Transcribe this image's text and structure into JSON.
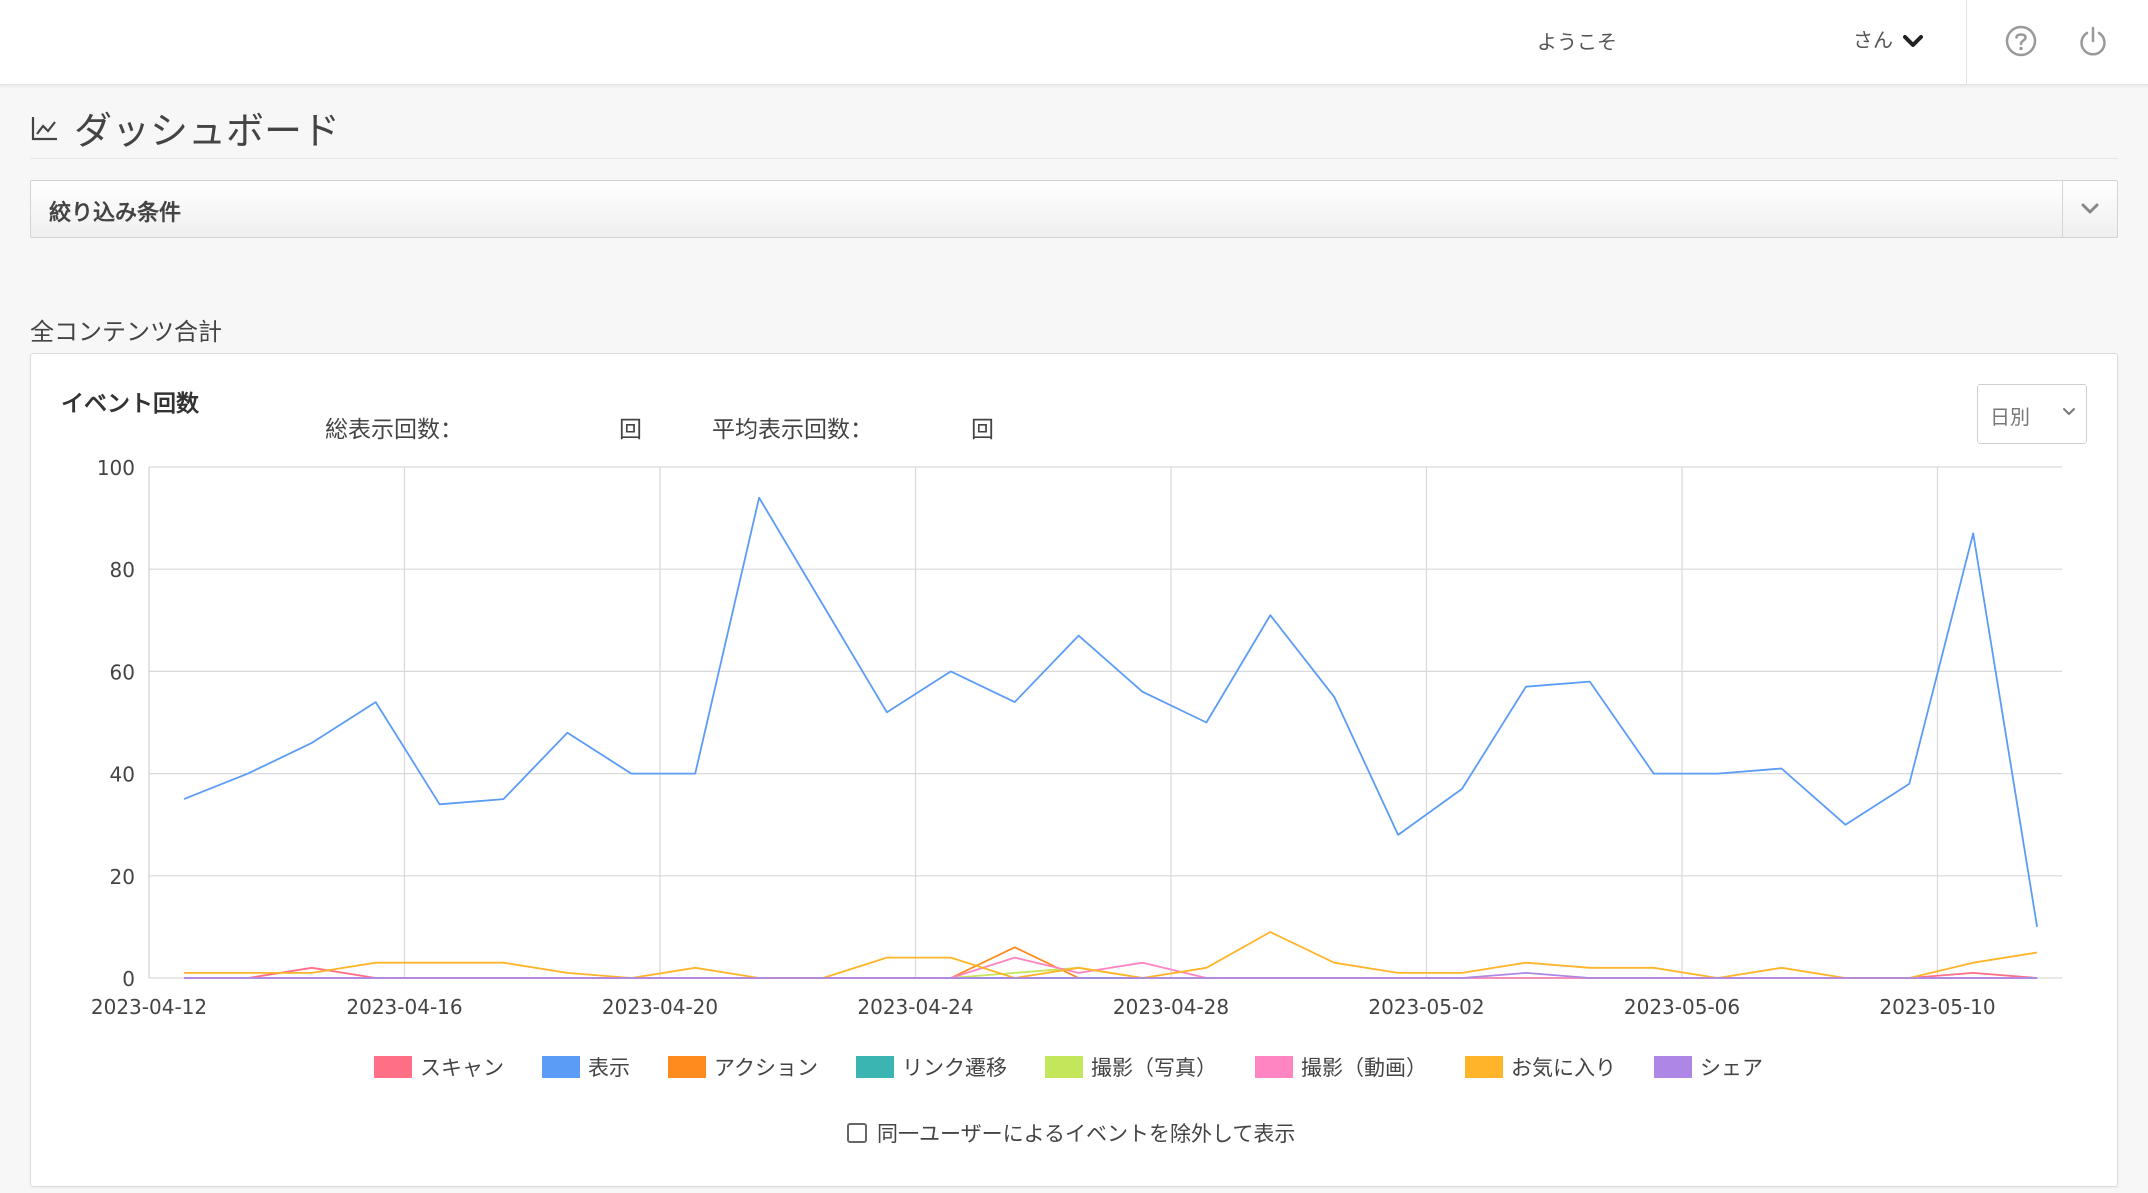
{
  "header": {
    "welcome": "ようこそ",
    "user_suffix": "さん",
    "help_icon": "question-circle-icon",
    "power_icon": "power-icon"
  },
  "page": {
    "title": "ダッシュボード",
    "title_icon": "line-chart-icon"
  },
  "filter": {
    "label": "絞り込み条件"
  },
  "section": {
    "title": "全コンテンツ合計"
  },
  "chart_card": {
    "title": "イベント回数",
    "total_label": "総表示回数：",
    "total_unit": "回",
    "avg_label": "平均表示回数：",
    "avg_unit": "回",
    "period_select": {
      "selected": "日別"
    },
    "exclude_label": "同一ユーザーによるイベントを除外して表示",
    "exclude_checked": false
  },
  "chart_data": {
    "type": "line",
    "x": [
      "2023-04-12",
      "2023-04-13",
      "2023-04-14",
      "2023-04-15",
      "2023-04-16",
      "2023-04-17",
      "2023-04-18",
      "2023-04-19",
      "2023-04-20",
      "2023-04-21",
      "2023-04-22",
      "2023-04-23",
      "2023-04-24",
      "2023-04-25",
      "2023-04-26",
      "2023-04-27",
      "2023-04-28",
      "2023-04-29",
      "2023-04-30",
      "2023-05-01",
      "2023-05-02",
      "2023-05-03",
      "2023-05-04",
      "2023-05-05",
      "2023-05-06",
      "2023-05-07",
      "2023-05-08",
      "2023-05-09",
      "2023-05-10",
      "2023-05-11"
    ],
    "x_ticks": [
      "2023-04-12",
      "2023-04-16",
      "2023-04-20",
      "2023-04-24",
      "2023-04-28",
      "2023-05-02",
      "2023-05-06",
      "2023-05-10"
    ],
    "ylim": [
      0,
      100
    ],
    "y_ticks": [
      0,
      20,
      40,
      60,
      80,
      100
    ],
    "grid": true,
    "legend_position": "bottom",
    "series": [
      {
        "name": "スキャン",
        "color": "#ff6f86",
        "values": [
          0,
          0,
          2,
          0,
          0,
          0,
          0,
          0,
          0,
          0,
          0,
          0,
          0,
          0,
          0,
          0,
          0,
          0,
          0,
          0,
          0,
          0,
          0,
          0,
          0,
          0,
          0,
          0,
          1,
          0
        ]
      },
      {
        "name": "表示",
        "color": "#5b9cf6",
        "values": [
          35,
          40,
          46,
          54,
          34,
          35,
          48,
          40,
          40,
          94,
          73,
          52,
          60,
          54,
          67,
          56,
          50,
          71,
          55,
          28,
          37,
          57,
          58,
          40,
          40,
          41,
          30,
          38,
          87,
          10
        ]
      },
      {
        "name": "アクション",
        "color": "#ff8a1e",
        "values": [
          0,
          0,
          0,
          0,
          0,
          0,
          0,
          0,
          0,
          0,
          0,
          0,
          0,
          6,
          0,
          0,
          0,
          0,
          0,
          0,
          0,
          0,
          0,
          0,
          0,
          0,
          0,
          0,
          0,
          0
        ]
      },
      {
        "name": "リンク遷移",
        "color": "#3ab5b2",
        "values": [
          0,
          0,
          0,
          0,
          0,
          0,
          0,
          0,
          0,
          0,
          0,
          0,
          0,
          0,
          0,
          0,
          0,
          0,
          0,
          0,
          0,
          0,
          0,
          0,
          0,
          0,
          0,
          0,
          0,
          0
        ]
      },
      {
        "name": "撮影（写真）",
        "color": "#c4e65a",
        "values": [
          0,
          0,
          0,
          0,
          0,
          0,
          0,
          0,
          0,
          0,
          0,
          0,
          0,
          1,
          2,
          0,
          0,
          0,
          0,
          0,
          0,
          0,
          0,
          0,
          0,
          0,
          0,
          0,
          0,
          0
        ]
      },
      {
        "name": "撮影（動画）",
        "color": "#ff85c2",
        "values": [
          0,
          0,
          0,
          0,
          0,
          0,
          0,
          0,
          0,
          0,
          0,
          0,
          0,
          4,
          1,
          3,
          0,
          0,
          0,
          0,
          0,
          0,
          0,
          0,
          0,
          0,
          0,
          0,
          0,
          0
        ]
      },
      {
        "name": "お気に入り",
        "color": "#ffb42a",
        "values": [
          1,
          1,
          1,
          3,
          3,
          3,
          1,
          0,
          2,
          0,
          0,
          4,
          4,
          0,
          2,
          0,
          2,
          9,
          3,
          1,
          1,
          3,
          2,
          2,
          0,
          2,
          0,
          0,
          3,
          5
        ]
      },
      {
        "name": "シェア",
        "color": "#ad86e6",
        "values": [
          0,
          0,
          0,
          0,
          0,
          0,
          0,
          0,
          0,
          0,
          0,
          0,
          0,
          0,
          0,
          0,
          0,
          0,
          0,
          0,
          0,
          1,
          0,
          0,
          0,
          0,
          0,
          0,
          0,
          0
        ]
      }
    ]
  }
}
